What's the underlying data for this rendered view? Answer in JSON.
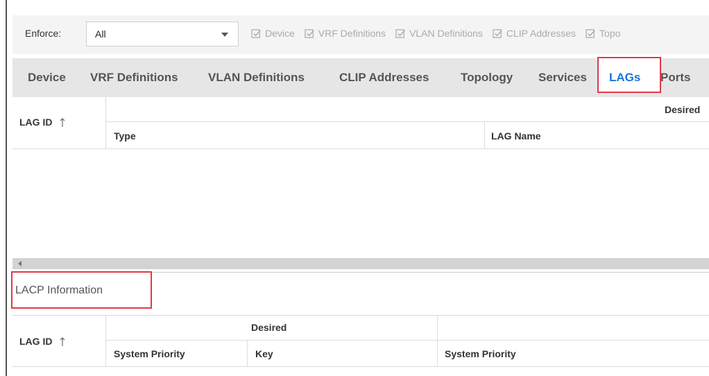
{
  "enforce": {
    "label": "Enforce:",
    "value": "All",
    "checkboxes": [
      "Device",
      "VRF Definitions",
      "VLAN Definitions",
      "CLIP Addresses",
      "Topo"
    ]
  },
  "tabs": {
    "device": "Device",
    "vrf": "VRF Definitions",
    "vlan": "VLAN Definitions",
    "clip": "CLIP Addresses",
    "topology": "Topology",
    "services": "Services",
    "lags": "LAGs",
    "ports": "Ports"
  },
  "lag_table": {
    "lag_id": "LAG ID",
    "desired": "Desired",
    "type": "Type",
    "lag_name": "LAG Name"
  },
  "lacp": {
    "title": "LACP Information",
    "lag_id": "LAG ID",
    "desired": "Desired",
    "system_priority": "System Priority",
    "key": "Key",
    "system_priority_2": "System Priority"
  },
  "colors": {
    "accent": "#1a73d9",
    "highlight": "#e0394a",
    "disabled_text": "#aaaaaa"
  }
}
